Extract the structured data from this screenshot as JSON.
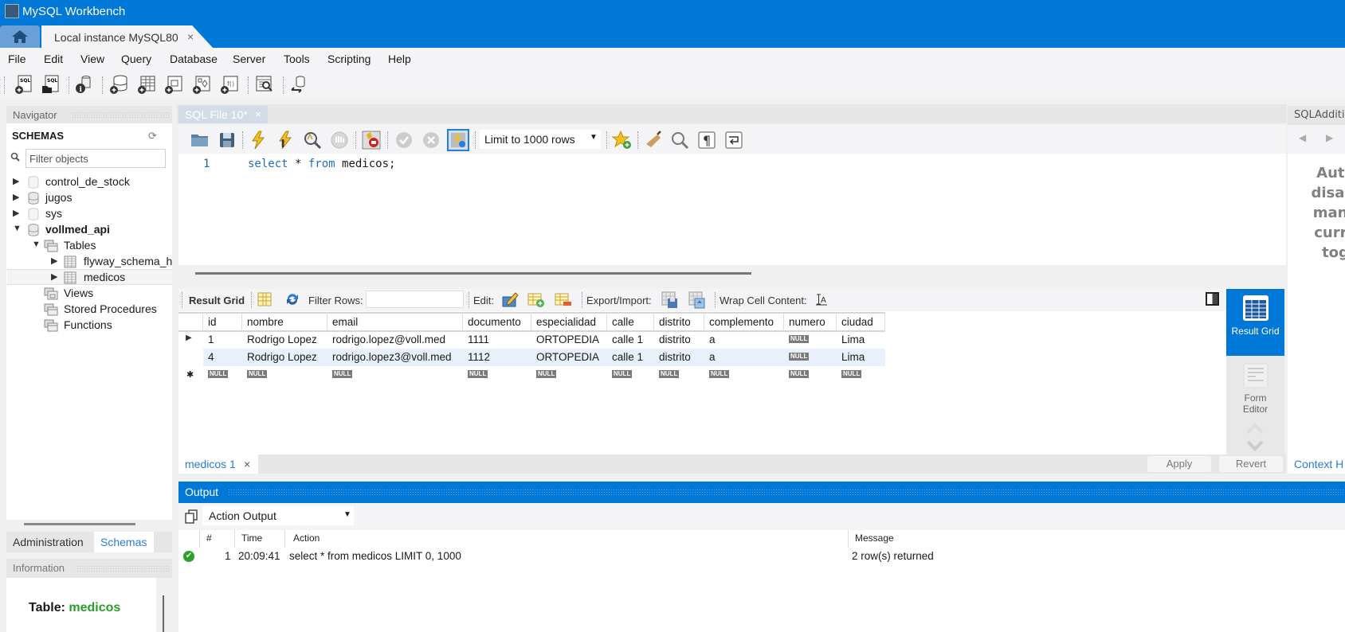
{
  "window": {
    "title": "MySQL Workbench"
  },
  "tabs": {
    "connection_tab": "Local instance MySQL80",
    "close": "×"
  },
  "menu": [
    "File",
    "Edit",
    "View",
    "Query",
    "Database",
    "Server",
    "Tools",
    "Scripting",
    "Help"
  ],
  "main_toolbar": {
    "icons": [
      "new-sql-tab-icon",
      "open-sql-script-icon",
      "schema-inspector-icon",
      "create-schema-icon",
      "create-table-icon",
      "create-view-icon",
      "create-procedure-icon",
      "create-function-icon",
      "search-table-data-icon",
      "reconnect-icon"
    ]
  },
  "navigator": {
    "title": "Navigator",
    "schemas_title": "SCHEMAS",
    "filter_placeholder": "Filter objects",
    "tree": [
      {
        "label": "control_de_stock",
        "expanded": false,
        "bold": false
      },
      {
        "label": "jugos",
        "expanded": false,
        "bold": false
      },
      {
        "label": "sys",
        "expanded": false,
        "bold": false
      },
      {
        "label": "vollmed_api",
        "expanded": true,
        "bold": true
      },
      {
        "label": "Tables",
        "expanded": true
      },
      {
        "label": "flyway_schema_h",
        "expanded": false
      },
      {
        "label": "medicos",
        "expanded": false,
        "selected": true
      },
      {
        "label": "Views"
      },
      {
        "label": "Stored Procedures"
      },
      {
        "label": "Functions"
      }
    ],
    "bottom_tabs": {
      "administration": "Administration",
      "schemas": "Schemas"
    },
    "information": {
      "title": "Information",
      "table_label": "Table:",
      "table_name": "medicos"
    }
  },
  "sql_editor": {
    "tab_label": "SQL File 10*",
    "tab_close": "×",
    "limit_rows": "Limit to 1000 rows",
    "line_number": "1",
    "code": {
      "kw1": "select",
      "mid": " * ",
      "kw2": "from",
      "rest": " medicos;"
    }
  },
  "result": {
    "toolbar": {
      "result_grid": "Result Grid",
      "filter_rows": "Filter Rows:",
      "filter_value": "",
      "edit": "Edit:",
      "export_import": "Export/Import:",
      "wrap_cell": "Wrap Cell Content:"
    },
    "columns": [
      "id",
      "nombre",
      "email",
      "documento",
      "especialidad",
      "calle",
      "distrito",
      "complemento",
      "numero",
      "ciudad"
    ],
    "rows": [
      [
        "1",
        "Rodrigo Lopez",
        "rodrigo.lopez@voll.med",
        "1111",
        "ORTOPEDIA",
        "calle 1",
        "distrito",
        "a",
        "NULL",
        "Lima"
      ],
      [
        "4",
        "Rodrigo Lopez",
        "rodrigo.lopez3@voll.med",
        "1112",
        "ORTOPEDIA",
        "calle 1",
        "distrito",
        "a",
        "NULL",
        "Lima"
      ]
    ],
    "new_row_placeholder": "NULL",
    "side_panel": {
      "result_grid": "Result Grid",
      "form_editor": "Form Editor"
    },
    "result_tab": "medicos 1",
    "apply": "Apply",
    "revert": "Revert"
  },
  "output": {
    "title": "Output",
    "selector": "Action Output",
    "columns": {
      "num": "#",
      "time": "Time",
      "action": "Action",
      "message": "Message"
    },
    "rows": [
      {
        "status": "success",
        "num": "1",
        "time": "20:09:41",
        "action": "select * from medicos LIMIT 0, 1000",
        "message": "2 row(s) returned"
      }
    ]
  },
  "sql_additions": {
    "title": "SQLAdditi",
    "text_lines": [
      "Auto",
      "disabl",
      "manu",
      "curre",
      "tog"
    ],
    "context_help": "Context H"
  },
  "colors": {
    "accent": "#0078d7",
    "link": "#2a7cd6",
    "success": "#2aa02a",
    "table_name": "#2a9c2a"
  }
}
